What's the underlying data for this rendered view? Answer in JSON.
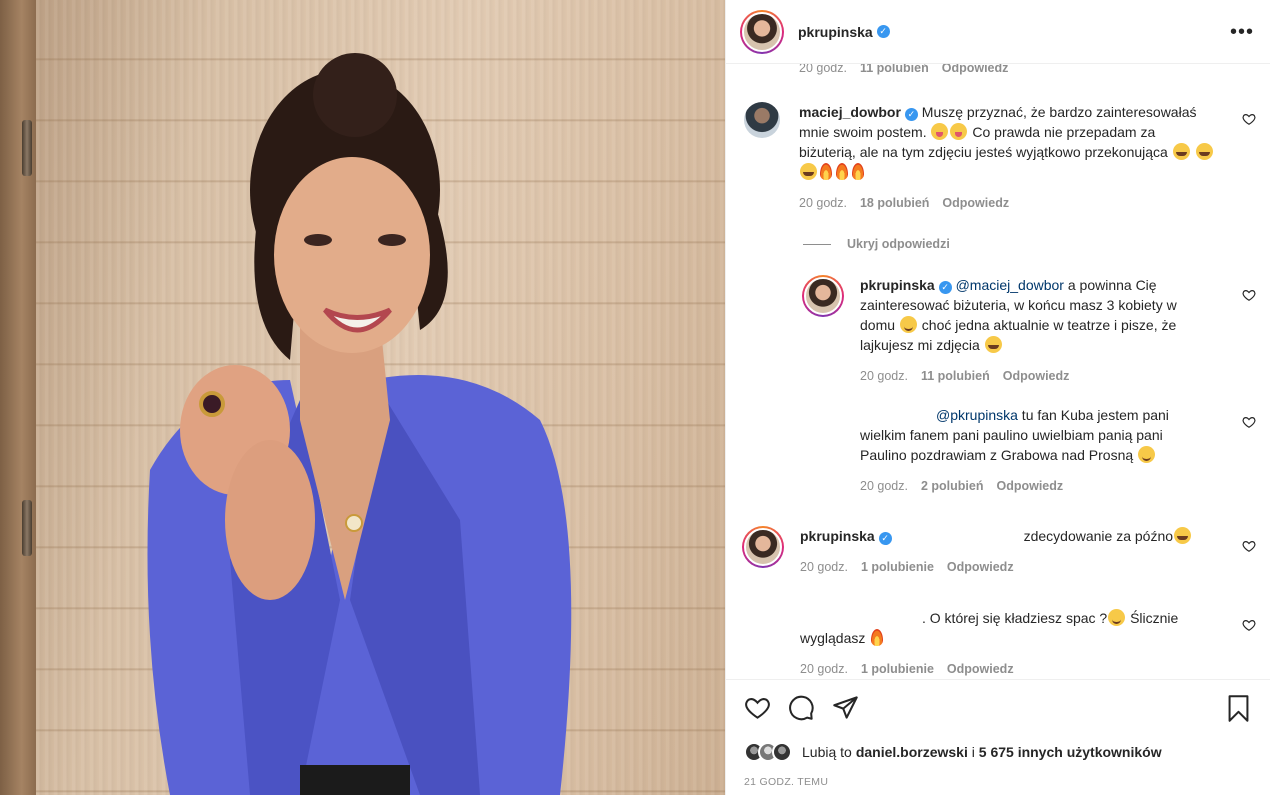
{
  "header": {
    "username": "pkrupinska",
    "verified_mark": "✓",
    "more_icon": "•••"
  },
  "top_meta": {
    "time": "20 godz.",
    "likes": "11 polubień",
    "reply": "Odpowiedz"
  },
  "comments": [
    {
      "username": "maciej_dowbor",
      "text_1": " Muszę przyznać, że bardzo zainteresowałaś mnie swoim postem.",
      "text_2": " Co prawda nie przepadam za biżuterią, ale na tym zdjęciu jesteś wyjątkowo przekonująca",
      "time": "20 godz.",
      "likes": "18 polubień",
      "reply": "Odpowiedz"
    }
  ],
  "hide_replies": "Ukryj odpowiedzi",
  "replies": [
    {
      "username": "pkrupinska",
      "mention": "@maciej_dowbor",
      "text_1": " a powinna Cię zainteresować biżuteria, w końcu masz 3 kobiety w domu",
      "text_2": " choć jedna aktualnie w teatrze i pisze, że lajkujesz mi zdjęcia",
      "time": "20 godz.",
      "likes": "11 polubień",
      "reply": "Odpowiedz"
    },
    {
      "mention": "@pkrupinska",
      "text": " tu fan Kuba jestem pani wielkim fanem pani paulino uwielbiam panią pani Paulino pozdrawiam z Grabowa nad Prosną",
      "time": "20 godz.",
      "likes": "2 polubień",
      "reply": "Odpowiedz"
    }
  ],
  "comment_3": {
    "username": "pkrupinska",
    "text": "zdecydowanie za późno",
    "time": "20 godz.",
    "likes": "1 polubienie",
    "reply": "Odpowiedz"
  },
  "comment_4": {
    "text_1": ". O której się kładziesz spac ?",
    "text_2": " Ślicznie wyglądasz",
    "time": "20 godz.",
    "likes": "1 polubienie",
    "reply": "Odpowiedz"
  },
  "likes_bar": {
    "prefix": "Lubią to ",
    "user": "daniel.borzewski",
    "middle": " i ",
    "others": "5 675 innych użytkowników"
  },
  "timestamp": "21 GODZ. TEMU",
  "icons": {
    "like": "heart-icon",
    "comment": "comment-icon",
    "share": "paper-plane-icon",
    "save": "bookmark-icon"
  },
  "colors": {
    "verified": "#3897f0",
    "mention": "#00376b",
    "muted": "#8e8e8e"
  }
}
